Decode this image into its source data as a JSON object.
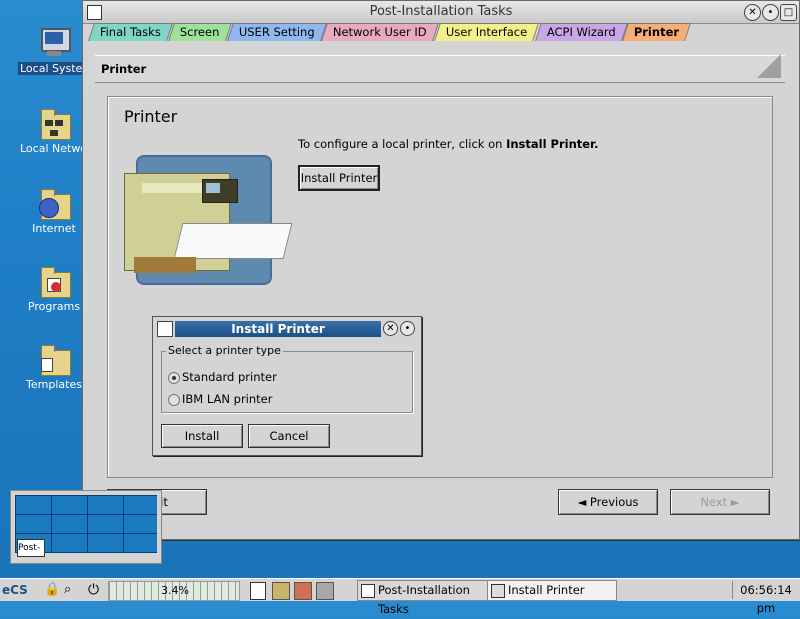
{
  "desktop": {
    "icons": [
      {
        "label": "Local System",
        "icon": "monitor-icon"
      },
      {
        "label": "Local Network",
        "icon": "network-folder-icon"
      },
      {
        "label": "Internet",
        "icon": "globe-folder-icon"
      },
      {
        "label": "Programs",
        "icon": "programs-folder-icon"
      },
      {
        "label": "Templates",
        "icon": "templates-folder-icon"
      }
    ]
  },
  "window": {
    "title": "Post-Installation Tasks",
    "tabs": [
      {
        "label": "Final Tasks",
        "color": "#7fd6c6"
      },
      {
        "label": "Screen",
        "color": "#9fe09a"
      },
      {
        "label": "USER Setting",
        "color": "#8fb7f0"
      },
      {
        "label": "Network User ID",
        "color": "#e8a9c2"
      },
      {
        "label": "User Interface",
        "color": "#f3f08a"
      },
      {
        "label": "ACPI Wizard",
        "color": "#c9a7e6"
      },
      {
        "label": "Printer",
        "color": "#f5ae78",
        "active": true
      }
    ],
    "section_header": "Printer",
    "panel": {
      "heading": "Printer",
      "instruction_prefix": "To configure a local printer, click on ",
      "instruction_bold": "Install Printer.",
      "install_button": "Install Printer"
    },
    "footer": {
      "exit": "Exit",
      "previous": "◄ Previous",
      "next": "Next ►"
    }
  },
  "dialog": {
    "title": "Install Printer",
    "group_label": "Select a printer type",
    "options": [
      {
        "label": "Standard printer",
        "selected": true
      },
      {
        "label": "IBM LAN printer",
        "selected": false
      }
    ],
    "install": "Install",
    "cancel": "Cancel"
  },
  "pager": {
    "label": "Post-"
  },
  "taskbar": {
    "cpu_load": "3.4%",
    "tasks": [
      {
        "label": "Post-Installation Tasks"
      },
      {
        "label": "Install Printer"
      }
    ],
    "clock": "06:56:14 pm"
  },
  "colors": {
    "title_active": "#1d4f86",
    "active_tab": "#f5ae78"
  }
}
